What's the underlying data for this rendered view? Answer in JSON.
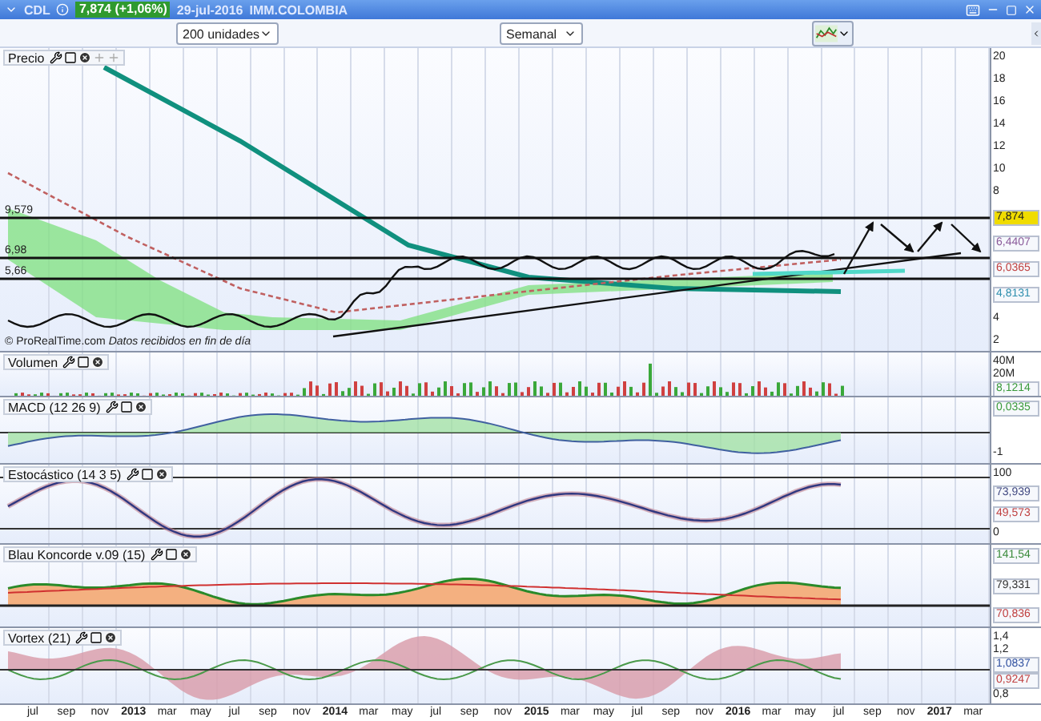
{
  "title_bar": {
    "symbol": "CDL",
    "quote_badge": "7,874 (+1,06%)",
    "date": "29-jul-2016",
    "market": "IMM.COLOMBIA"
  },
  "toolbar": {
    "units_dropdown": "200 unidades",
    "period_dropdown": "Semanal"
  },
  "panels": [
    {
      "kind": "price",
      "title": "Precio",
      "levels": [
        "9,579",
        "6,98",
        "5,66"
      ],
      "note": "© ProRealTime.com *Datos recibidos en fin de día*",
      "axis": [
        {
          "kind": "tick",
          "text": "20"
        },
        {
          "kind": "tick",
          "text": "18"
        },
        {
          "kind": "tick",
          "text": "16"
        },
        {
          "kind": "tick",
          "text": "14"
        },
        {
          "kind": "tick",
          "text": "12"
        },
        {
          "kind": "tick",
          "text": "10"
        },
        {
          "kind": "tick",
          "text": "8"
        },
        {
          "kind": "badge",
          "text": "7,874",
          "color": "#f0dc00"
        },
        {
          "kind": "value",
          "text": "6,4407",
          "color": "#8a5a9a"
        },
        {
          "kind": "value",
          "text": "6,0365",
          "color": "#c04040"
        },
        {
          "kind": "value",
          "text": "4,8131",
          "color": "#2f8fae"
        },
        {
          "kind": "tick",
          "text": "4"
        },
        {
          "kind": "tick",
          "text": "2"
        }
      ]
    },
    {
      "kind": "volume",
      "title": "Volumen",
      "axis": [
        {
          "kind": "tick",
          "text": "40M"
        },
        {
          "kind": "tick",
          "text": "20M"
        },
        {
          "kind": "value",
          "text": "8,1214",
          "color": "#3a9a3a"
        }
      ]
    },
    {
      "kind": "macd",
      "title": "MACD (12 26 9)",
      "axis": [
        {
          "kind": "value",
          "text": "0,0335",
          "color": "#3a9a3a"
        },
        {
          "kind": "tick",
          "text": "-1"
        }
      ]
    },
    {
      "kind": "stochastic",
      "title": "Estocástico (14 3 5)",
      "axis": [
        {
          "kind": "tick",
          "text": "100"
        },
        {
          "kind": "value",
          "text": "73,939",
          "color": "#404880"
        },
        {
          "kind": "value",
          "text": "49,573",
          "color": "#c04040"
        },
        {
          "kind": "tick",
          "text": "0"
        }
      ]
    },
    {
      "kind": "blau",
      "title": "Blau Koncorde v.09 (15)",
      "axis": [
        {
          "kind": "value",
          "text": "141,54",
          "color": "#3a8a3a"
        },
        {
          "kind": "value",
          "text": "79,331",
          "color": "#303030"
        },
        {
          "kind": "value",
          "text": "70,836",
          "color": "#c04040"
        }
      ]
    },
    {
      "kind": "vortex",
      "title": "Vortex (21)",
      "axis": [
        {
          "kind": "tick",
          "text": "1,4"
        },
        {
          "kind": "tick",
          "text": "1,2"
        },
        {
          "kind": "value",
          "text": "1,0837",
          "color": "#3050a0"
        },
        {
          "kind": "value",
          "text": "0,9247",
          "color": "#c04040"
        },
        {
          "kind": "tick",
          "text": "0,8"
        }
      ]
    }
  ],
  "x_axis": [
    {
      "text": "jul",
      "year": false
    },
    {
      "text": "sep",
      "year": false
    },
    {
      "text": "nov",
      "year": false
    },
    {
      "text": "2013",
      "year": true
    },
    {
      "text": "mar",
      "year": false
    },
    {
      "text": "may",
      "year": false
    },
    {
      "text": "jul",
      "year": false
    },
    {
      "text": "sep",
      "year": false
    },
    {
      "text": "nov",
      "year": false
    },
    {
      "text": "2014",
      "year": true
    },
    {
      "text": "mar",
      "year": false
    },
    {
      "text": "may",
      "year": false
    },
    {
      "text": "jul",
      "year": false
    },
    {
      "text": "sep",
      "year": false
    },
    {
      "text": "nov",
      "year": false
    },
    {
      "text": "2015",
      "year": true
    },
    {
      "text": "mar",
      "year": false
    },
    {
      "text": "may",
      "year": false
    },
    {
      "text": "jul",
      "year": false
    },
    {
      "text": "sep",
      "year": false
    },
    {
      "text": "nov",
      "year": false
    },
    {
      "text": "2016",
      "year": true
    },
    {
      "text": "mar",
      "year": false
    },
    {
      "text": "may",
      "year": false
    },
    {
      "text": "jul",
      "year": false
    },
    {
      "text": "sep",
      "year": false
    },
    {
      "text": "nov",
      "year": false
    },
    {
      "text": "2017",
      "year": true
    },
    {
      "text": "mar",
      "year": false
    }
  ]
}
